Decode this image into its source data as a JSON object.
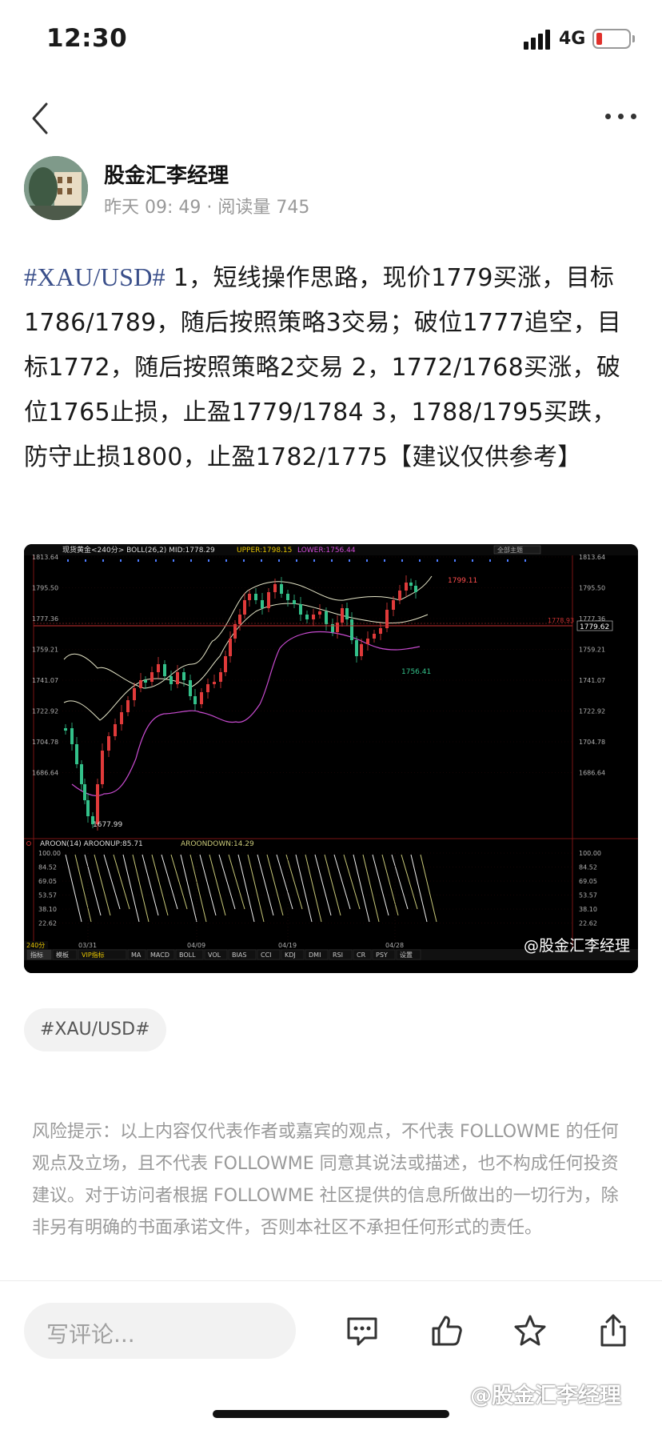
{
  "status_bar": {
    "time": "12:30",
    "network": "4G"
  },
  "author": {
    "name": "股金汇李经理",
    "meta": "昨天 09: 49 · 阅读量 745"
  },
  "post": {
    "hashtag": "#XAU/USD#",
    "body": " 1，短线操作思路，现价1779买涨，目标1786/1789，随后按照策略3交易；破位1777追空，目标1772，随后按照策略2交易 2，1772/1768买涨，破位1765止损，止盈1779/1784 3，1788/1795买跌，防守止损1800，止盈1782/1775【建议仅供参考】"
  },
  "chart": {
    "header_main": "现货黄金<240分> BOLL(26,2) MID:1778.29",
    "header_upper": "UPPER:1798.15",
    "header_lower": "LOWER:1756.44",
    "header_right": "全部主题",
    "y_labels_main": [
      "1813.64",
      "1795.50",
      "1777.36",
      "1759.21",
      "1741.07",
      "1722.92",
      "1704.78",
      "1686.64"
    ],
    "y_labels_sub": [
      "100.00",
      "84.52",
      "69.05",
      "53.57",
      "38.10",
      "22.62"
    ],
    "price_high": "1799.11",
    "price_low": "1677.99",
    "price_mid_low": "1756.41",
    "current_price": "1779.62",
    "price_line_tag": "1778.93",
    "indicator_header": "AROON(14) AROONUP:85.71",
    "indicator_down": "AROONDOWN:14.29",
    "x_dates": [
      "03/31",
      "04/09",
      "04/19",
      "04/28"
    ],
    "period": "240分",
    "tabs": [
      "指标",
      "模板",
      "VIP指标",
      "MA",
      "MACD",
      "BOLL",
      "VOL",
      "BIAS",
      "CCI",
      "KDJ",
      "DMI",
      "RSI",
      "CR",
      "PSY",
      "设置"
    ],
    "watermark": "@股金汇李经理",
    "colors": {
      "up": "#e03a3a",
      "down": "#33c18a",
      "mid": "#e6e6c8",
      "lower": "#c84bd0",
      "aroon_up": "#f0f0f0",
      "aroon_down": "#c8c878"
    }
  },
  "tag": "#XAU/USD#",
  "risk_notice": "风险提示：以上内容仅代表作者或嘉宾的观点，不代表 FOLLOWME 的任何观点及立场，且不代表 FOLLOWME 同意其说法或描述，也不构成任何投资建议。对于访问者根据 FOLLOWME 社区提供的信息所做出的一切行为，除非另有明确的书面承诺文件，否则本社区不承担任何形式的责任。",
  "bottom_bar": {
    "comment_placeholder": "写评论..."
  },
  "page_watermark": "@股金汇李经理"
}
